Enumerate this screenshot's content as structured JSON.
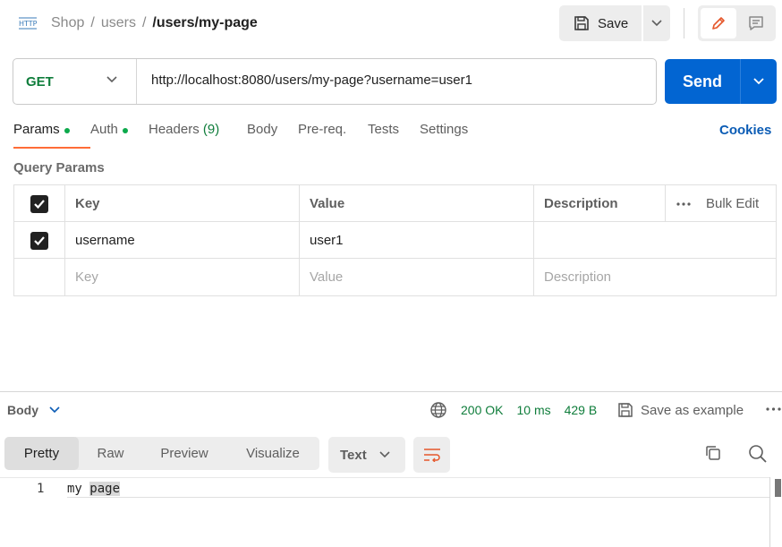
{
  "breadcrumb": {
    "items": [
      "Shop",
      "users"
    ],
    "separator": "/",
    "current": "/users/my-page"
  },
  "toolbar": {
    "save_label": "Save"
  },
  "request": {
    "method": "GET",
    "url": "http://localhost:8080/users/my-page?username=user1",
    "send_label": "Send"
  },
  "tabs": [
    {
      "label": "Params",
      "dot": true,
      "active": true
    },
    {
      "label": "Auth",
      "dot": true
    },
    {
      "label": "Headers",
      "count": "(9)"
    },
    {
      "label": "Body"
    },
    {
      "label": "Pre-req."
    },
    {
      "label": "Tests"
    },
    {
      "label": "Settings"
    }
  ],
  "cookies_label": "Cookies",
  "query_params": {
    "title": "Query Params",
    "headers": {
      "key": "Key",
      "value": "Value",
      "description": "Description",
      "bulk_edit": "Bulk Edit"
    },
    "rows": [
      {
        "checked": true,
        "key": "username",
        "value": "user1",
        "description": ""
      }
    ],
    "placeholders": {
      "key": "Key",
      "value": "Value",
      "description": "Description"
    }
  },
  "response": {
    "body_label": "Body",
    "status": "200 OK",
    "time": "10 ms",
    "size": "429 B",
    "save_example_label": "Save as example",
    "view_modes": [
      "Pretty",
      "Raw",
      "Preview",
      "Visualize"
    ],
    "active_view": "Pretty",
    "format": "Text",
    "lines": [
      {
        "num": "1",
        "text_before": "my ",
        "highlight": "page"
      }
    ]
  },
  "colors": {
    "accent": "#ff6c37",
    "send_blue": "#0265d2",
    "method_green": "#0f7d3b",
    "status_green": "#0f7d3b",
    "link_blue": "#0b5cb5"
  },
  "icons": [
    "http-icon",
    "save-icon",
    "chevron-down-icon",
    "pencil-icon",
    "comment-icon",
    "globe-icon",
    "more-icon",
    "wrap-icon",
    "copy-icon",
    "search-icon",
    "checkbox-checked-icon"
  ]
}
